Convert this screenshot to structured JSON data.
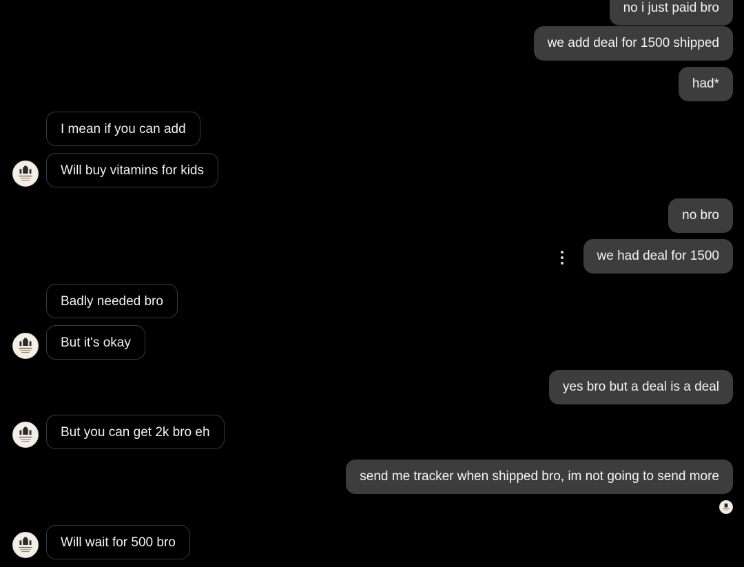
{
  "messages": [
    {
      "from": "me",
      "text": "no i just paid bro"
    },
    {
      "from": "me",
      "text": "we add deal for 1500 shipped"
    },
    {
      "from": "me",
      "text": "had*"
    },
    {
      "from": "them",
      "text": "I mean if you can add"
    },
    {
      "from": "them",
      "text": "Will buy vitamins for kids"
    },
    {
      "from": "me",
      "text": "no bro"
    },
    {
      "from": "me",
      "text": "we had deal for 1500"
    },
    {
      "from": "them",
      "text": "Badly needed bro"
    },
    {
      "from": "them",
      "text": "But it's okay"
    },
    {
      "from": "me",
      "text": "yes bro but a deal is a deal"
    },
    {
      "from": "them",
      "text": "But you can get 2k bro eh"
    },
    {
      "from": "me",
      "text": "send me tracker when shipped bro, im not going to send more"
    },
    {
      "from": "them",
      "text": "Will wait for 500 bro"
    }
  ],
  "icons": {
    "avatar": "contact-avatar-icon",
    "more": "more-options-icon",
    "seen": "seen-receipt-avatar-icon"
  },
  "colors": {
    "background": "#000000",
    "my_bubble": "#3d3d3e",
    "their_bubble_border": "#3a3a3a",
    "text": "#f4f4f4"
  }
}
